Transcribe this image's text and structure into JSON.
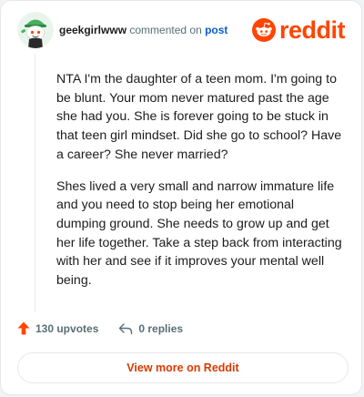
{
  "header": {
    "username": "geekgirlwww",
    "action_text": " commented on ",
    "post_link_text": "post",
    "brand_name": "reddit"
  },
  "comment": {
    "paragraphs": [
      "NTA I'm the daughter of a teen mom. I'm going to be blunt. Your mom never matured past the age she had you. She is forever going to be stuck in that teen girl mindset. Did she go to school? Have a career? She never married?",
      "Shes lived a very small and narrow immature life and you need to stop being her emotional dumping ground. She needs to grow up and get her life together. Take a step back from interacting with her and see if it improves your mental well being."
    ]
  },
  "actions": {
    "upvotes_label": "130 upvotes",
    "replies_label": "0 replies"
  },
  "footer": {
    "view_more_label": "View more on Reddit"
  },
  "colors": {
    "brand_orange": "#ff4500",
    "link_blue": "#0a5ec7",
    "avatar_green": "#46b15d",
    "view_more_text": "#d93a00"
  },
  "icons": {
    "avatar": "snoo-avatar-icon",
    "brand": "reddit-logo-icon",
    "upvote": "upvote-arrow-icon",
    "reply": "reply-arrow-icon"
  }
}
